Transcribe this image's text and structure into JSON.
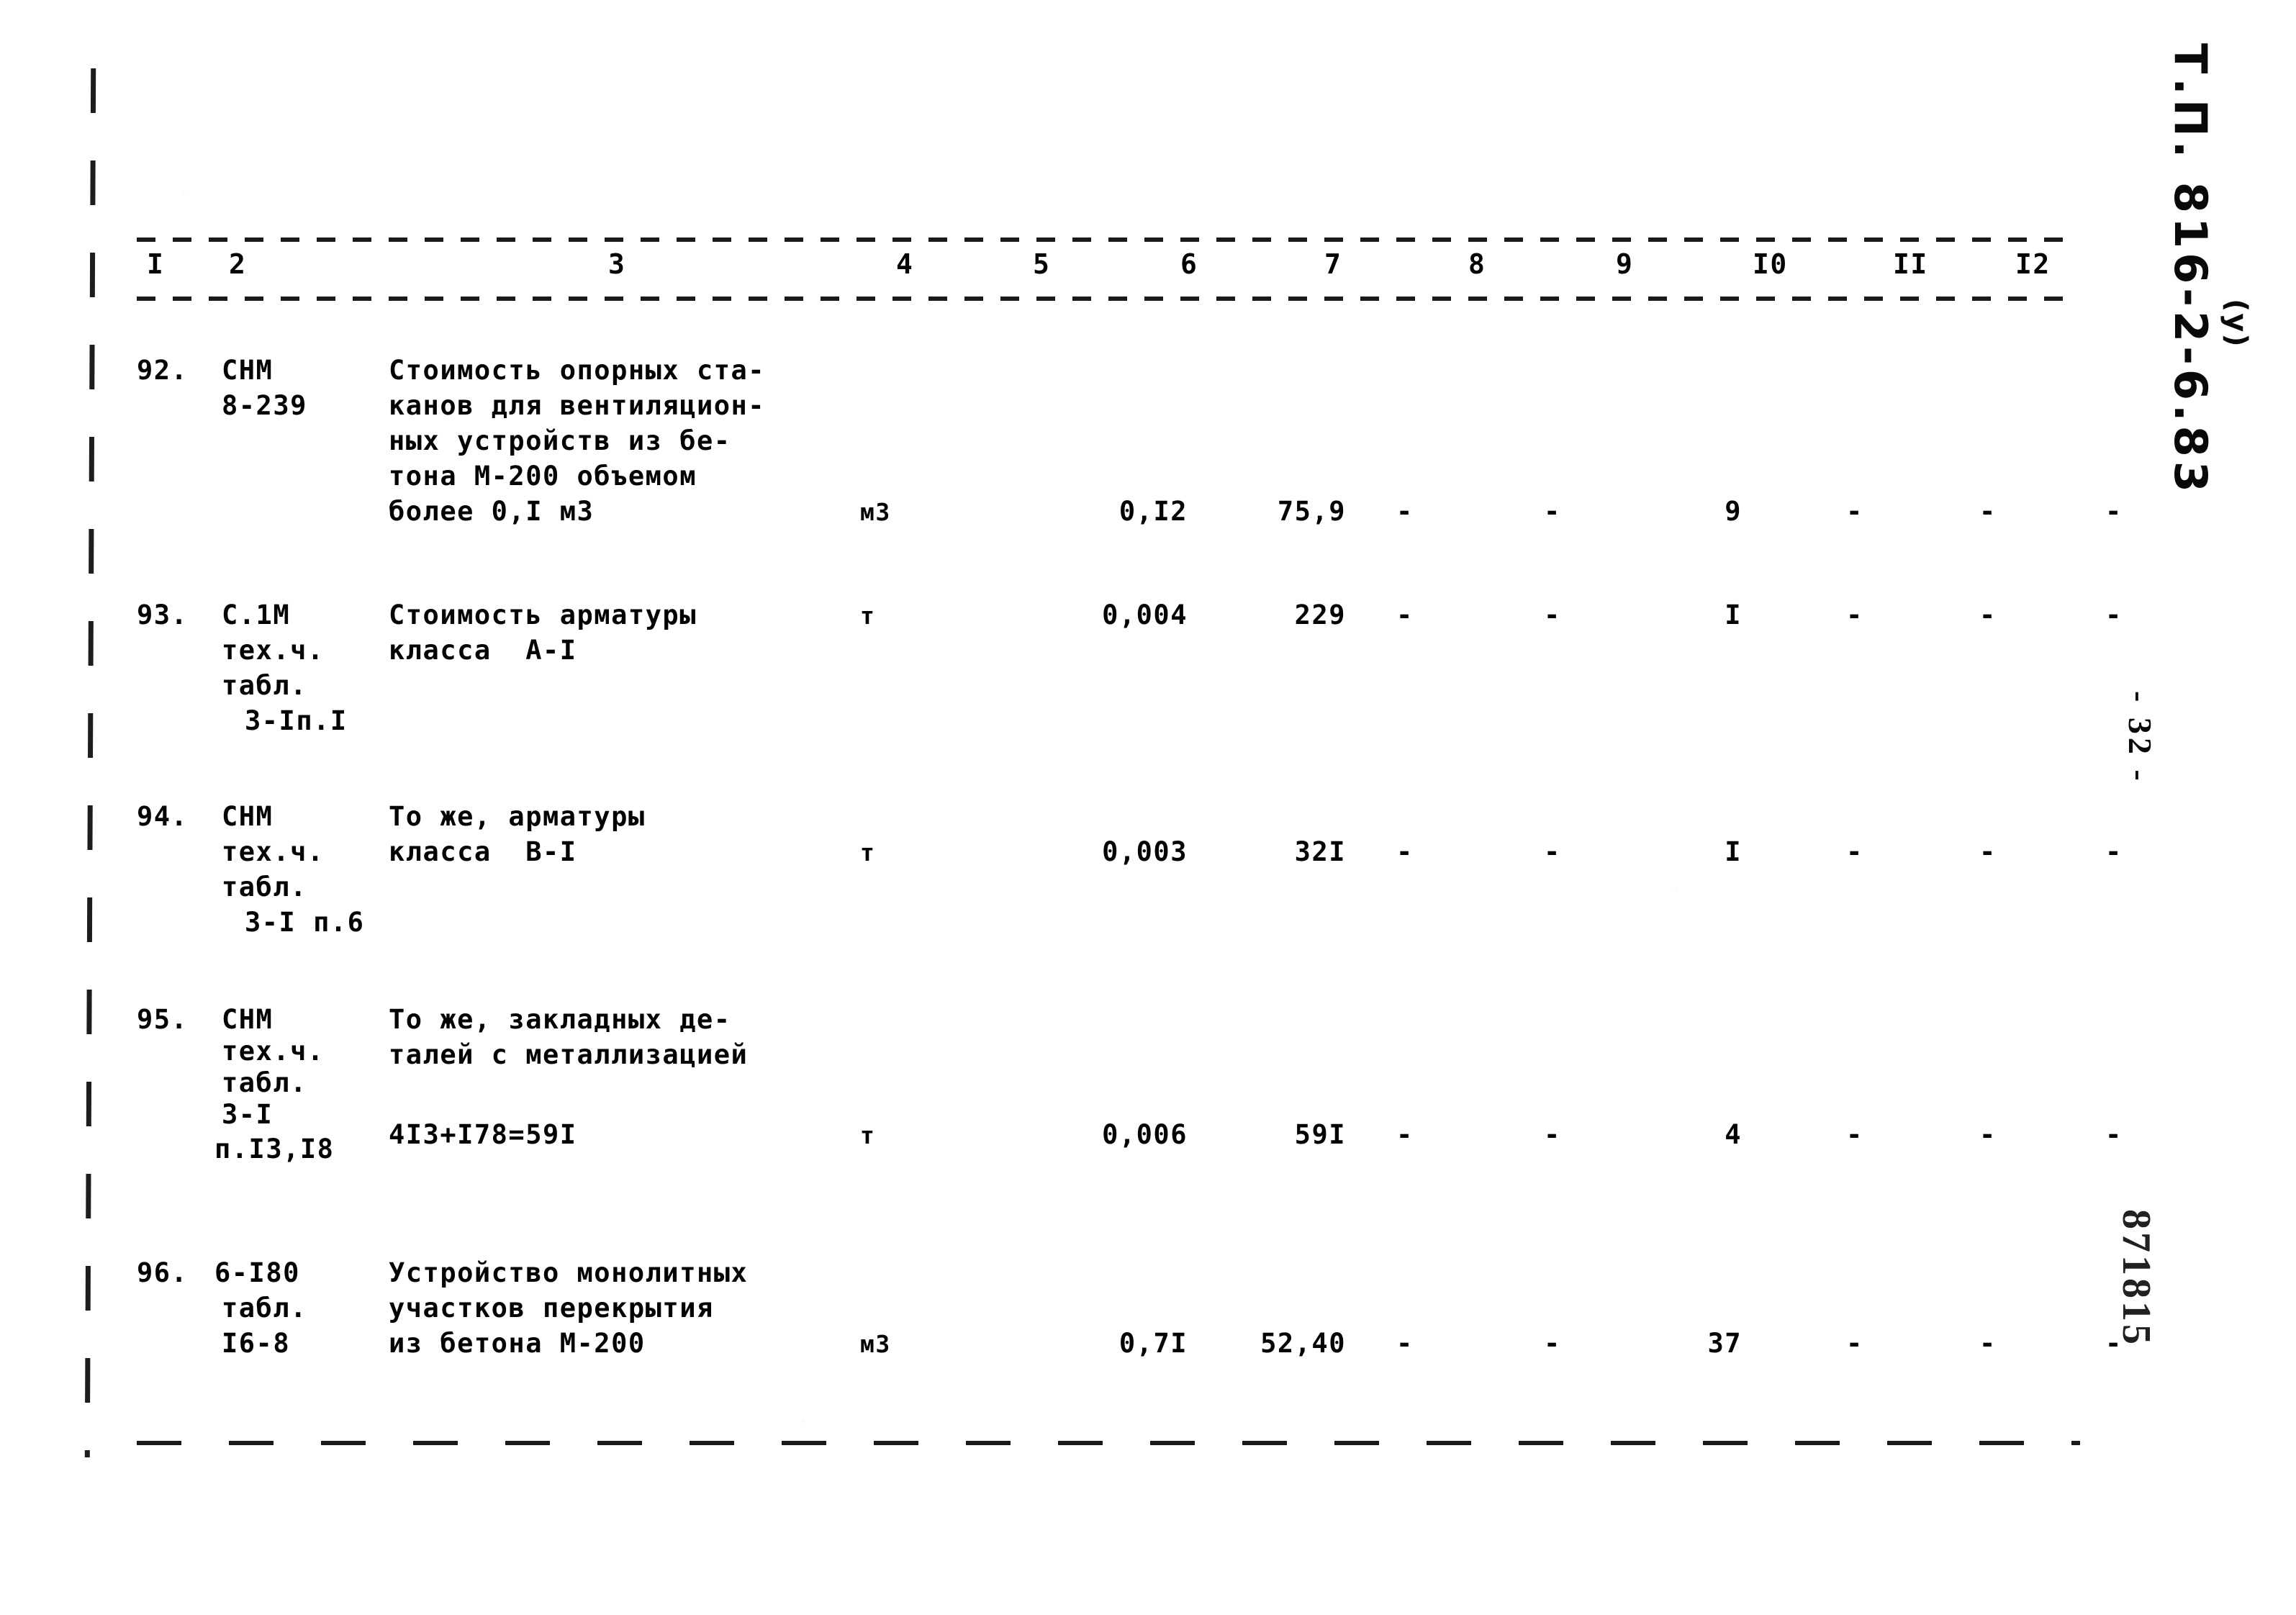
{
  "document": {
    "code": "Т.П. 816-2-6.83",
    "code_suffix": "(у)",
    "page_number": "- 32 -",
    "inventory_number": "871815"
  },
  "table": {
    "column_headers": [
      "I",
      "2",
      "3",
      "4",
      "5",
      "6",
      "7",
      "8",
      "9",
      "I0",
      "II",
      "I2"
    ],
    "rows": [
      {
        "no": "92.",
        "code_lines": [
          "СНМ",
          "8-239"
        ],
        "description_lines": [
          "Стоимость опорных ста-",
          "канов для вентиляцион-",
          "ных устройств из бе-",
          "тона М-200 объемом",
          "более 0,I м3"
        ],
        "unit": "м3",
        "col5": "0,I2",
        "col6": "75,9",
        "col7": "-",
        "col8": "-",
        "col9": "9",
        "col10": "-",
        "col11": "-",
        "col12": "-"
      },
      {
        "no": "93.",
        "code_lines": [
          "С.1М",
          "тех.ч.",
          "табл.",
          "3-Iп.I"
        ],
        "description_lines": [
          "Стоимость арматуры",
          "класса  А-I"
        ],
        "unit": "т",
        "col5": "0,004",
        "col6": "229",
        "col7": "-",
        "col8": "-",
        "col9": "I",
        "col10": "-",
        "col11": "-",
        "col12": "-"
      },
      {
        "no": "94.",
        "code_lines": [
          "СНМ",
          "тех.ч.",
          "табл.",
          "3-I п.6"
        ],
        "description_lines": [
          "То же, арматуры",
          "класса  В-I"
        ],
        "unit": "т",
        "col5": "0,003",
        "col6": "32I",
        "col7": "-",
        "col8": "-",
        "col9": "I",
        "col10": "-",
        "col11": "-",
        "col12": "-"
      },
      {
        "no": "95.",
        "code_lines": [
          "СНМ",
          "тех.ч.",
          "табл.",
          "3-I",
          "п.I3,I8"
        ],
        "description_lines": [
          "То же, закладных де-",
          "талей с металлизацией",
          "",
          "4I3+I78=59I"
        ],
        "unit": "т",
        "col5": "0,006",
        "col6": "59I",
        "col7": "-",
        "col8": "-",
        "col9": "4",
        "col10": "-",
        "col11": "-",
        "col12": "-"
      },
      {
        "no": "96.",
        "code_lines": [
          "6-I80",
          "табл.",
          "I6-8"
        ],
        "description_lines": [
          "Устройство монолитных",
          "участков перекрытия",
          "из бетона М-200"
        ],
        "unit": "м3",
        "col5": "0,7I",
        "col6": "52,40",
        "col7": "-",
        "col8": "-",
        "col9": "37",
        "col10": "-",
        "col11": "-",
        "col12": "-"
      }
    ]
  }
}
